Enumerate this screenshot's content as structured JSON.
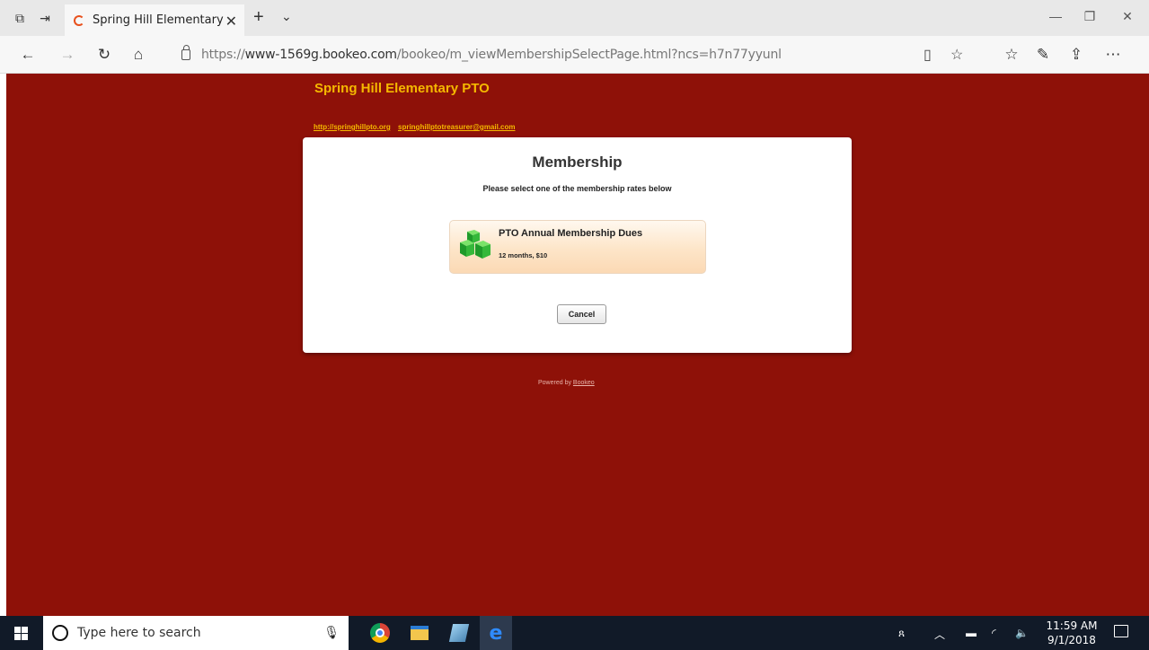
{
  "browser": {
    "tab_title": "Spring Hill Elementary F",
    "url_prefix": "https://",
    "url_host": "www-1569g.bookeo.com",
    "url_path": "/bookeo/m_viewMembershipSelectPage.html?ncs=h7n77yyunl"
  },
  "page": {
    "site_title": "Spring Hill Elementary PTO",
    "links": [
      "http://springhillpto.org",
      "springhillptotreasurer@gmail.com"
    ],
    "card_title": "Membership",
    "card_subtitle": "Please select one of the membership rates below",
    "option": {
      "name": "PTO Annual Membership Dues",
      "description": "12 months, $10"
    },
    "cancel_label": "Cancel",
    "powered_by": "Powered by",
    "powered_link": "Bookeo",
    "colors": {
      "background": "#8e1108",
      "title": "#f5b800",
      "option_gradient": "#fde5c8"
    }
  },
  "taskbar": {
    "search_placeholder": "Type here to search",
    "time": "11:59 AM",
    "date": "9/1/2018"
  }
}
